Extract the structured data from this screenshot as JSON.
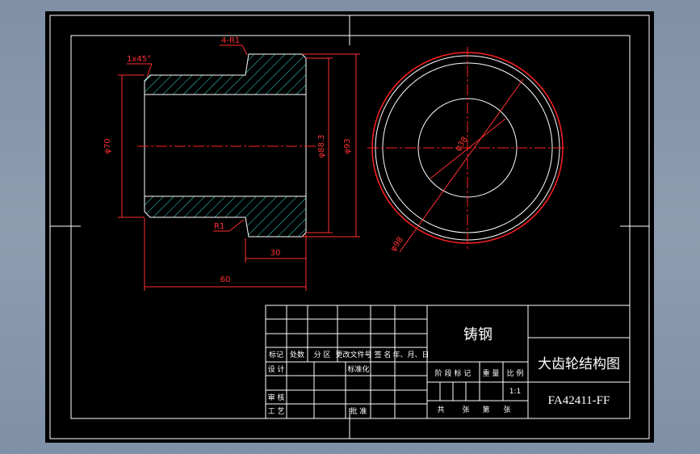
{
  "drawing": {
    "chamfer_label": "1x45°",
    "fillet_top_label": "4-R1",
    "fillet_bottom_label": "R1",
    "dia_70": "φ70",
    "dia_88": "φ88.3",
    "dia_93": "φ93",
    "length_30": "30",
    "length_60": "60",
    "circle_small_label": "φ38",
    "circle_large_label": "φ98"
  },
  "title_block": {
    "material": "铸钢",
    "title": "大齿轮结构图",
    "drawing_number": "FA42411-FF",
    "scale_value": "1:1",
    "headers": {
      "mark": "标记",
      "count": "处数",
      "zone": "分 区",
      "change_doc": "更改文件号",
      "signature": "签 名",
      "date": "年、月、日"
    },
    "roles": {
      "design": "设 计",
      "standardize": "标准化",
      "check": "审 核",
      "process": "工 艺",
      "approve": "批 准"
    },
    "stage_header": {
      "stage_mark": "阶 段 标 记",
      "weight": "重 量",
      "scale": "比 例"
    },
    "sheets_row": {
      "total": "共",
      "sheets1": "张",
      "page": "第",
      "sheets2": "张"
    }
  },
  "colors": {
    "outline": "#ffffff",
    "hatch": "#2fe0d0",
    "dimension": "#ff3030",
    "centerline": "#ff2020"
  }
}
